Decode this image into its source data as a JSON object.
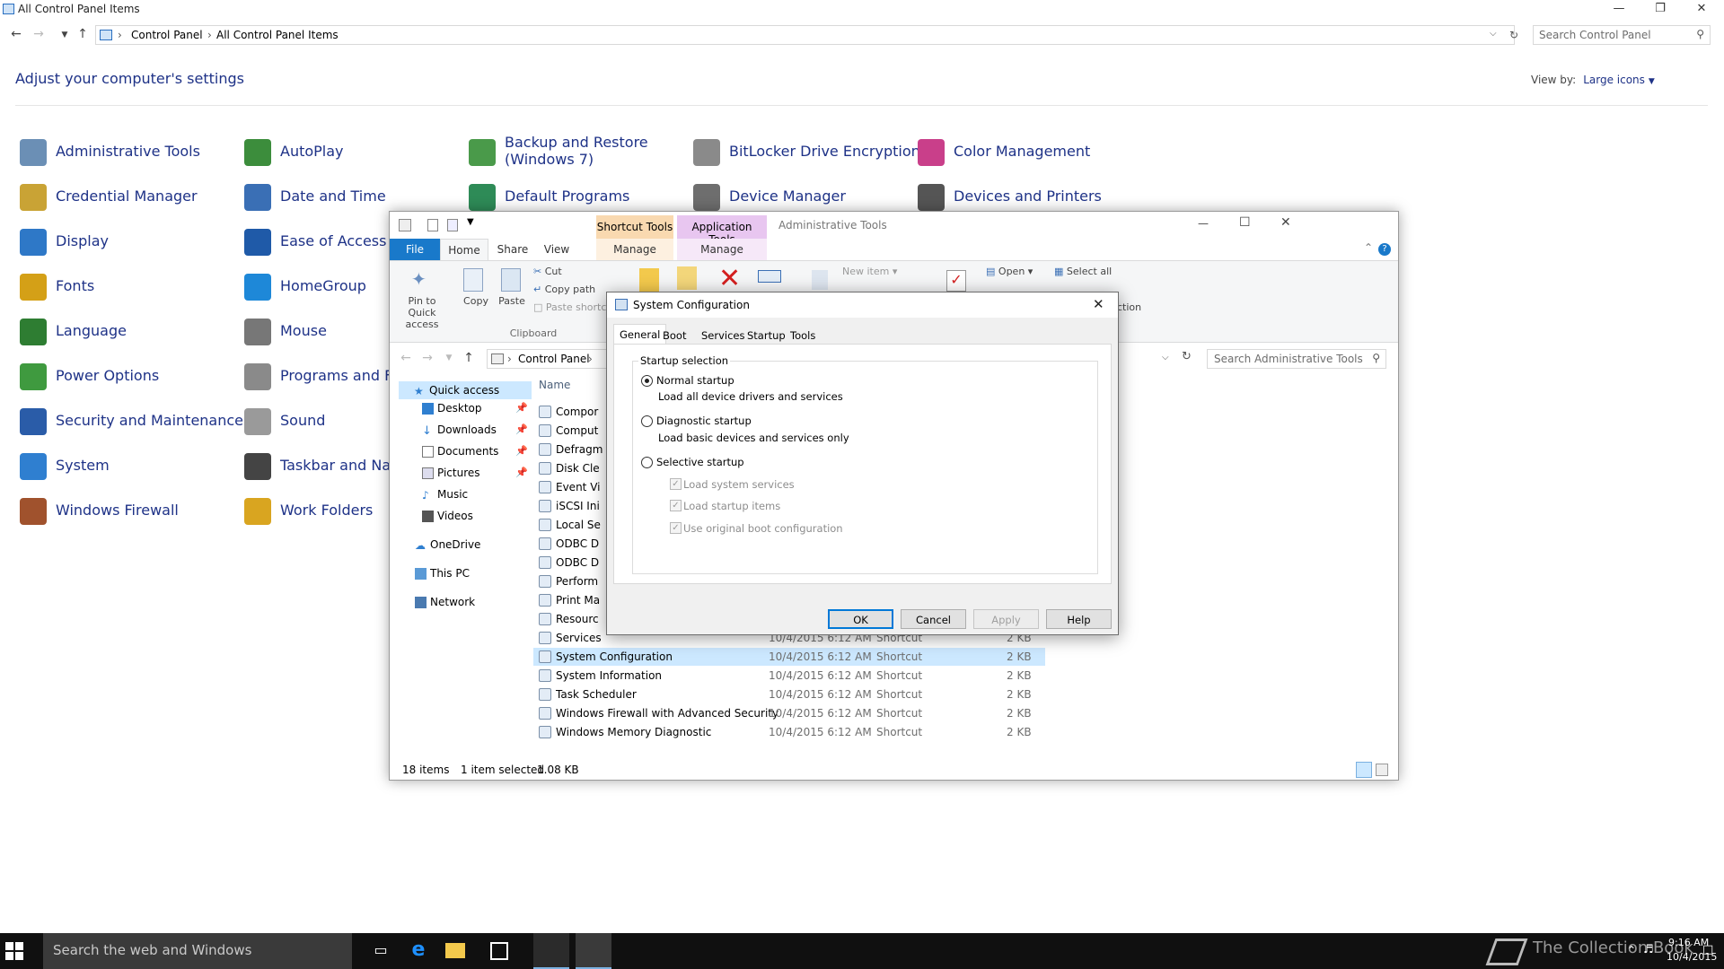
{
  "cp": {
    "window_title": "All Control Panel Items",
    "breadcrumb": [
      "Control Panel",
      "All Control Panel Items"
    ],
    "search_placeholder": "Search Control Panel",
    "heading": "Adjust your computer's settings",
    "view_by_label": "View by:",
    "view_by_value": "Large icons",
    "items": [
      {
        "label": "Administrative Tools",
        "color": "#6b8fb5"
      },
      {
        "label": "AutoPlay",
        "color": "#3c8d3c"
      },
      {
        "label": "Backup and Restore",
        "label2": "(Windows 7)",
        "color": "#4a9a4a"
      },
      {
        "label": "BitLocker Drive Encryption",
        "color": "#8a8a8a"
      },
      {
        "label": "Color Management",
        "color": "#c93f8a"
      },
      {
        "label": "Credential Manager",
        "color": "#c9a335"
      },
      {
        "label": "Date and Time",
        "color": "#3a6fb5"
      },
      {
        "label": "Default Programs",
        "color": "#2e8b57"
      },
      {
        "label": "Device Manager",
        "color": "#6e6e6e"
      },
      {
        "label": "Devices and Printers",
        "color": "#555555"
      },
      {
        "label": "Display",
        "color": "#2e78c7"
      },
      {
        "label": "Ease of Access Ce",
        "color": "#1f5aa8"
      },
      {
        "label": "Fonts",
        "color": "#d4a017"
      },
      {
        "label": "HomeGroup",
        "color": "#1e88d8"
      },
      {
        "label": "Language",
        "color": "#2e7d32"
      },
      {
        "label": "Mouse",
        "color": "#777777"
      },
      {
        "label": "Power Options",
        "color": "#3f9a3f"
      },
      {
        "label": "Programs and Fea",
        "color": "#8a8a8a"
      },
      {
        "label": "Security and Maintenance",
        "color": "#2a5ca8"
      },
      {
        "label": "Sound",
        "color": "#9a9a9a"
      },
      {
        "label": "System",
        "color": "#2f7fd0"
      },
      {
        "label": "Taskbar and Navig",
        "color": "#444444"
      },
      {
        "label": "Windows Firewall",
        "color": "#a0522d"
      },
      {
        "label": "Work Folders",
        "color": "#d9a520"
      }
    ]
  },
  "explorer": {
    "ctx_shortcut": "Shortcut Tools",
    "ctx_application": "Application Tools",
    "title": "Administrative Tools",
    "tabs": [
      "File",
      "Home",
      "Share",
      "View",
      "Manage",
      "Manage"
    ],
    "ribbon": {
      "pin": "Pin to Quick",
      "pin2": "access",
      "copy": "Copy",
      "paste": "Paste",
      "cut": "Cut",
      "copy_path": "Copy path",
      "paste_shortcut": "Paste shortc",
      "clipboard": "Clipboard",
      "new_item": "New item",
      "open": "Open",
      "select_all": "Select all",
      "ction": "ction"
    },
    "path": [
      "Control Panel"
    ],
    "search_placeholder": "Search Administrative Tools",
    "nav": {
      "quick_access": "Quick access",
      "desktop": "Desktop",
      "downloads": "Downloads",
      "documents": "Documents",
      "pictures": "Pictures",
      "music": "Music",
      "videos": "Videos",
      "onedrive": "OneDrive",
      "this_pc": "This PC",
      "network": "Network"
    },
    "col_name": "Name",
    "files_partial": [
      "Compor",
      "Comput",
      "Defragm",
      "Disk Cle",
      "Event Vi",
      "iSCSI Ini",
      "Local Se",
      "ODBC D",
      "ODBC D",
      "Perform",
      "Print Ma",
      "Resourc"
    ],
    "files": [
      {
        "name": "Services",
        "date": "10/4/2015 6:12 AM",
        "type": "Shortcut",
        "size": "2 KB"
      },
      {
        "name": "System Configuration",
        "date": "10/4/2015 6:12 AM",
        "type": "Shortcut",
        "size": "2 KB"
      },
      {
        "name": "System Information",
        "date": "10/4/2015 6:12 AM",
        "type": "Shortcut",
        "size": "2 KB"
      },
      {
        "name": "Task Scheduler",
        "date": "10/4/2015 6:12 AM",
        "type": "Shortcut",
        "size": "2 KB"
      },
      {
        "name": "Windows Firewall with Advanced Security",
        "date": "10/4/2015 6:12 AM",
        "type": "Shortcut",
        "size": "2 KB"
      },
      {
        "name": "Windows Memory Diagnostic",
        "date": "10/4/2015 6:12 AM",
        "type": "Shortcut",
        "size": "2 KB"
      }
    ],
    "status_items": "18 items",
    "status_selected": "1 item selected",
    "status_size": "1.08 KB"
  },
  "dialog": {
    "title": "System Configuration",
    "tabs": [
      "General",
      "Boot",
      "Services",
      "Startup",
      "Tools"
    ],
    "group": "Startup selection",
    "normal": "Normal startup",
    "normal_desc": "Load all device drivers and services",
    "diagnostic": "Diagnostic startup",
    "diagnostic_desc": "Load basic devices and services only",
    "selective": "Selective startup",
    "chk1": "Load system services",
    "chk2": "Load startup items",
    "chk3": "Use original boot configuration",
    "ok": "OK",
    "cancel": "Cancel",
    "apply": "Apply",
    "help": "Help"
  },
  "taskbar": {
    "search": "Search the web and Windows",
    "watermark": "The Collection Book",
    "time": "9:16 AM",
    "date": "10/4/2015"
  }
}
